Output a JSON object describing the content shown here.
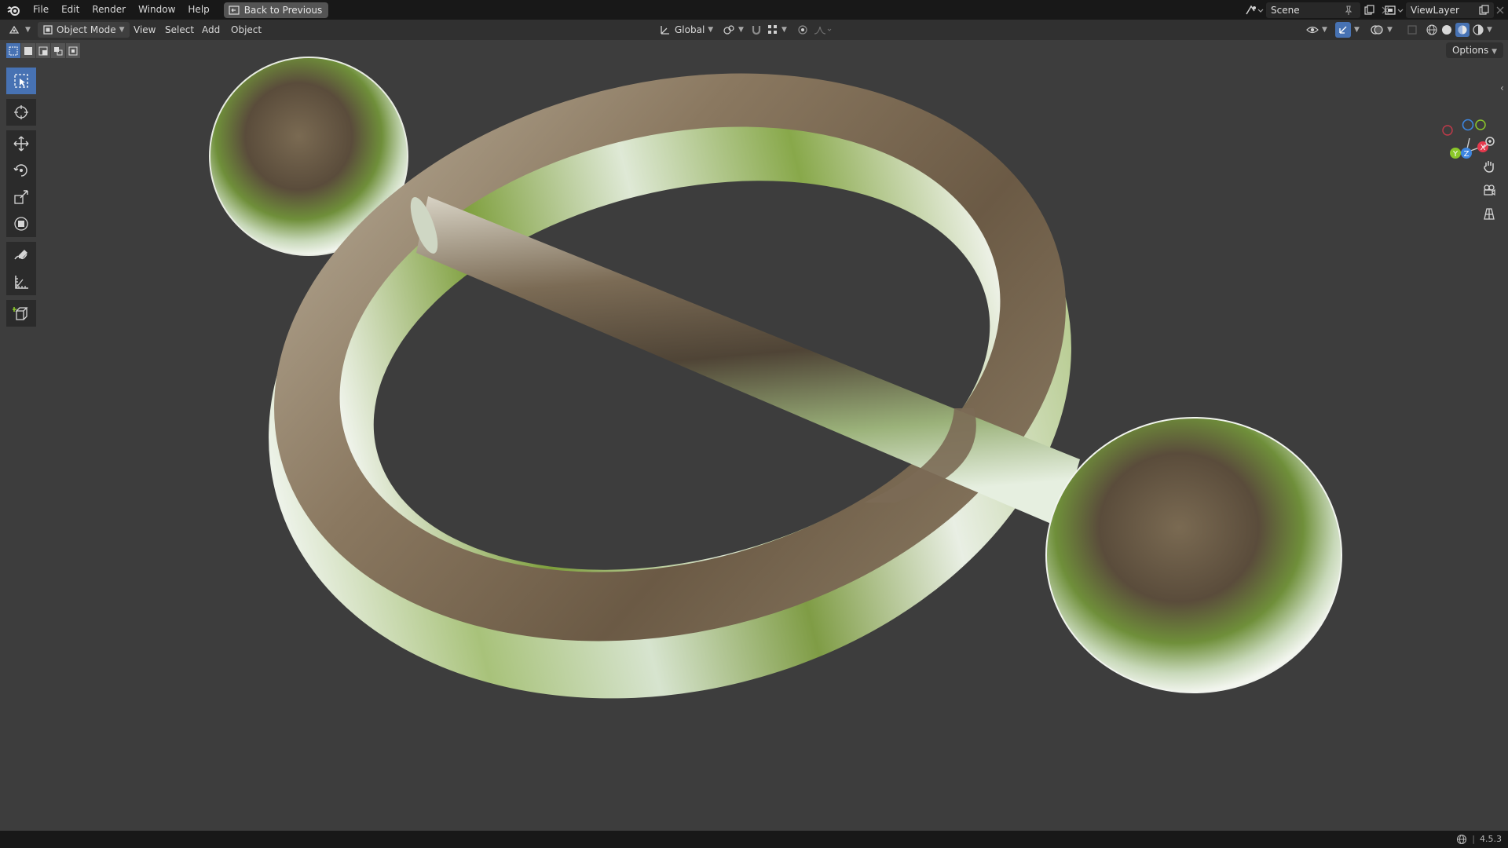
{
  "topbar": {
    "menus": [
      "File",
      "Edit",
      "Render",
      "Window",
      "Help"
    ],
    "back_label": "Back to Previous",
    "scene": "Scene",
    "view_layer": "ViewLayer"
  },
  "header": {
    "mode": "Object Mode",
    "menus": [
      "View",
      "Select",
      "Add",
      "Object"
    ],
    "orientation": "Global",
    "options": "Options"
  },
  "toolbar": {
    "tools": [
      "select-box",
      "cursor",
      "move",
      "rotate",
      "scale",
      "transform",
      "annotate",
      "measure",
      "add-cube"
    ],
    "active_tool": "select-box"
  },
  "gizmo": {
    "axes": [
      "X",
      "Y",
      "Z"
    ],
    "colors": {
      "x": "#e5394d",
      "y": "#8bc72a",
      "z": "#3d86e0"
    }
  },
  "status": {
    "version": "4.5.3"
  },
  "colors": {
    "accent": "#4772b3",
    "viewport_bg": "#3d3d3d",
    "topbar_bg": "#181818",
    "header_bg": "#303030"
  }
}
